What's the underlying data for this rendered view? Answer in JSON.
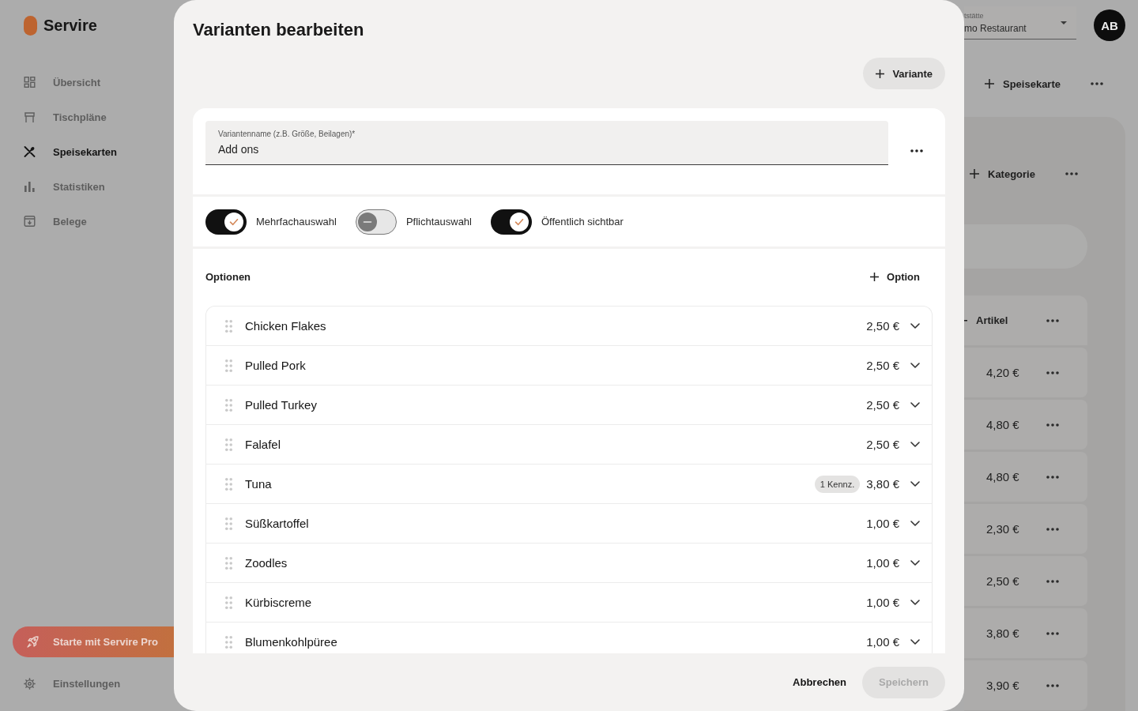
{
  "sidebar": {
    "brand": "Servire",
    "nav": [
      {
        "label": "Übersicht",
        "selected": false
      },
      {
        "label": "Tischpläne",
        "selected": false
      },
      {
        "label": "Speisekarten",
        "selected": true
      },
      {
        "label": "Statistiken",
        "selected": false
      },
      {
        "label": "Belege",
        "selected": false
      }
    ],
    "upgrade_button": "Starte mit Servire Pro",
    "settings": "Einstellungen"
  },
  "header": {
    "venue_select": {
      "label": "tstätte",
      "value": "mo Restaurant"
    },
    "avatar": "AB"
  },
  "menu_panel": {
    "add_menu_button": "Speisekarte",
    "add_category_button": "Kategorie",
    "add_item_button": "Artikel",
    "item_prices": [
      "4,20 €",
      "4,80 €",
      "4,80 €",
      "2,30 €",
      "2,50 €",
      "3,80 €",
      "3,90 €"
    ]
  },
  "dialog": {
    "title": "Varianten bearbeiten",
    "add_variant_button": "Variante",
    "name_field": {
      "label": "Variantenname (z.B. Größe, Beilagen)*",
      "value": "Add ons"
    },
    "toggles": [
      {
        "label": "Mehrfachauswahl",
        "on": true
      },
      {
        "label": "Pflichtauswahl",
        "on": false
      },
      {
        "label": "Öffentlich sichtbar",
        "on": true
      }
    ],
    "options": {
      "title": "Optionen",
      "add_button": "Option",
      "rows": [
        {
          "name": "Chicken Flakes",
          "price": "2,50 €"
        },
        {
          "name": "Pulled Pork",
          "price": "2,50 €"
        },
        {
          "name": "Pulled Turkey",
          "price": "2,50 €"
        },
        {
          "name": "Falafel",
          "price": "2,50 €"
        },
        {
          "name": "Tuna",
          "badge": "1 Kennz.",
          "price": "3,80 €"
        },
        {
          "name": "Süßkartoffel",
          "price": "1,00 €"
        },
        {
          "name": "Zoodles",
          "price": "1,00 €"
        },
        {
          "name": "Kürbiscreme",
          "price": "1,00 €"
        },
        {
          "name": "Blumenkohlpüree",
          "price": "1,00 €"
        }
      ]
    },
    "footer": {
      "cancel_button": "Abbrechen",
      "save_button": {
        "label": "Speichern",
        "disabled": true
      }
    }
  }
}
